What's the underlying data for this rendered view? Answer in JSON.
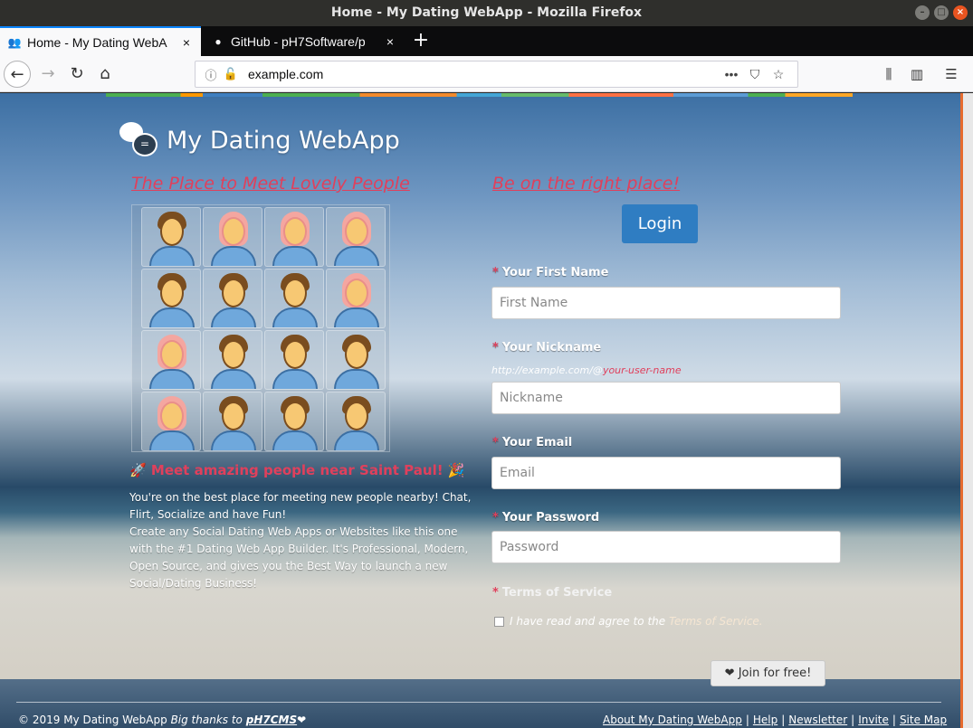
{
  "window": {
    "title": "Home - My Dating WebApp - Mozilla Firefox"
  },
  "tabs": [
    {
      "label": "Home - My Dating WebA",
      "icon": "people-icon"
    },
    {
      "label": "GitHub - pH7Software/p",
      "icon": "github-icon"
    }
  ],
  "urlbar": {
    "url": "example.com"
  },
  "site": {
    "name": "My Dating WebApp",
    "tagline_left": "The Place to Meet Lovely People",
    "tagline_right": "Be on the right place!",
    "login_label": "Login",
    "meet_text": "Meet amazing people near Saint Paul!",
    "desc_lines": [
      "You're on the best place for meeting new people nearby! Chat,",
      "Flirt, Socialize and have Fun!",
      "Create any Social Dating Web Apps or Websites like this one",
      "with the #1 Dating Web App Builder. It's Professional, Modern,",
      "Open Source, and gives you the Best Way to launch a new",
      "Social/Dating Business!"
    ]
  },
  "form": {
    "first_name": {
      "label": "Your First Name",
      "placeholder": "First Name"
    },
    "nickname": {
      "label": "Your Nickname",
      "placeholder": "Nickname",
      "hint_prefix": "http://example.com/@",
      "hint_suffix": "your-user-name"
    },
    "email": {
      "label": "Your Email",
      "placeholder": "Email"
    },
    "password": {
      "label": "Your Password",
      "placeholder": "Password"
    },
    "terms_label": "Terms of Service",
    "terms_text": "I have read and agree to the",
    "terms_link": "Terms of Service.",
    "join_label": "Join for free!"
  },
  "avatars": [
    "m",
    "f",
    "f",
    "f",
    "m",
    "m",
    "m",
    "f",
    "f",
    "m",
    "m",
    "m",
    "f",
    "m",
    "m",
    "m"
  ],
  "footer": {
    "copyright": "© 2019",
    "site": "My Dating WebApp",
    "thanks": "Big thanks to",
    "cms": "pH7CMS",
    "links": [
      "About My Dating WebApp",
      "Help",
      "Newsletter",
      "Invite",
      "Site Map"
    ]
  }
}
